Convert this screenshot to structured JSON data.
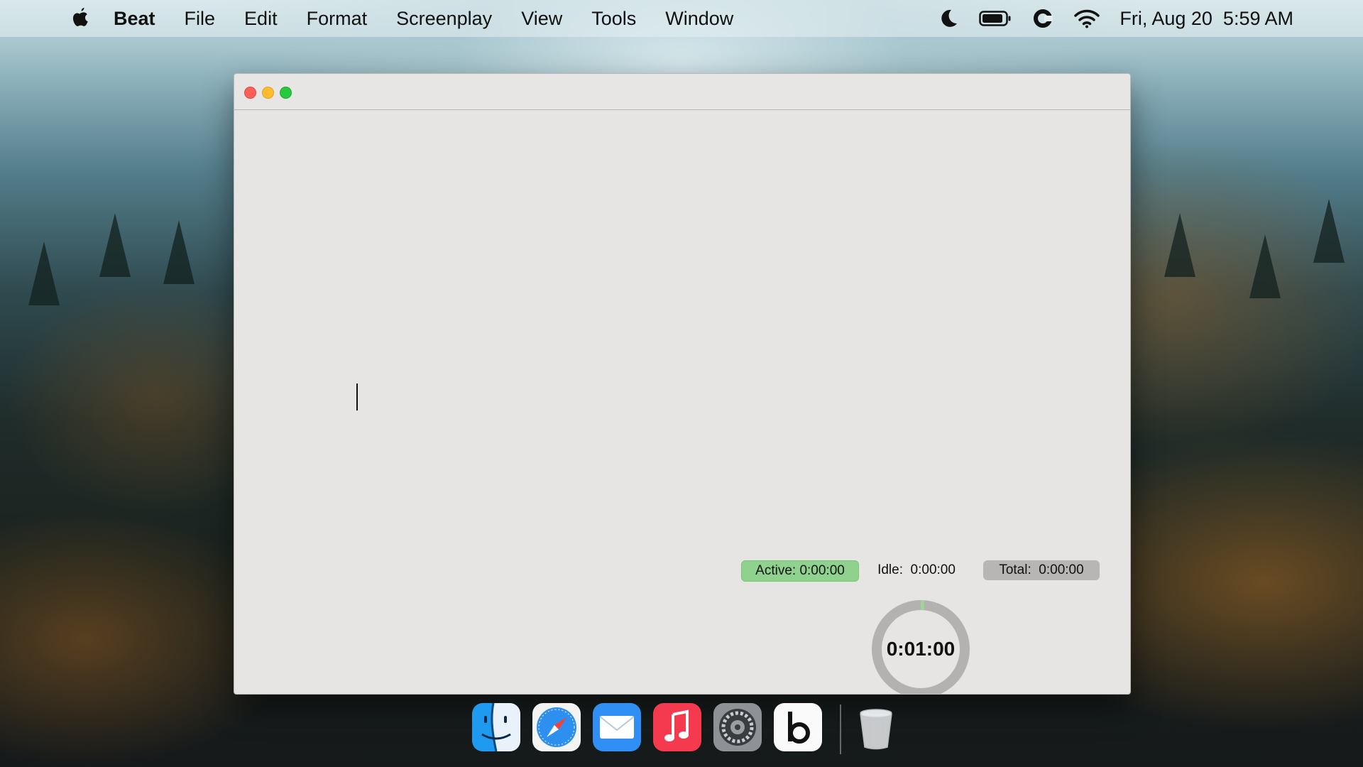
{
  "menubar": {
    "app_name": "Beat",
    "items": [
      "File",
      "Edit",
      "Format",
      "Screenplay",
      "View",
      "Tools",
      "Window"
    ],
    "status_icons": [
      "moon-icon",
      "battery-icon",
      "creative-cloud-icon",
      "wifi-icon"
    ],
    "clock": "Fri, Aug 20  5:59 AM"
  },
  "window": {
    "timer": {
      "active": "Active: 0:00:00",
      "idle": "Idle:  0:00:00",
      "total": "Total:  0:00:00",
      "countdown": "0:01:00"
    }
  },
  "dock": {
    "apps": [
      "finder-icon",
      "safari-icon",
      "mail-icon",
      "music-icon",
      "system-preferences-icon",
      "beat-icon",
      "trash-icon"
    ]
  },
  "colors": {
    "active_badge": "#8fd28d",
    "total_badge": "#b7b6b5",
    "close": "#fe5f57",
    "minimize": "#febc2e",
    "zoom": "#28c840"
  }
}
